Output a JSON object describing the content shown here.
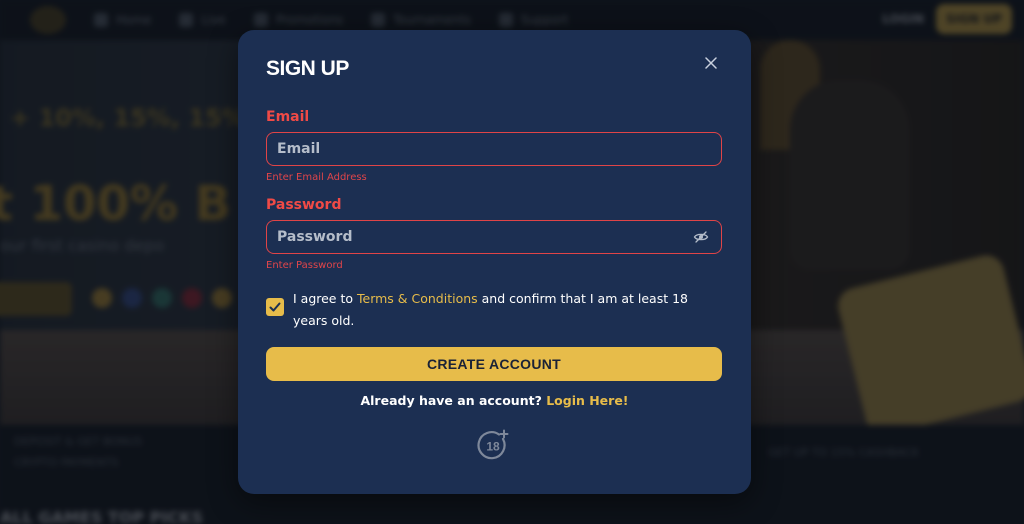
{
  "background": {
    "nav_items": [
      "Home",
      "Live",
      "Promotions",
      "Tournaments",
      "Support"
    ],
    "login_label": "LOGIN",
    "signup_label": "SIGN UP",
    "hero_line1": "+ 10%, 15%, 15%",
    "hero_line2": "t 100% B",
    "hero_line3": "our first casino depo",
    "bottom_text1": "DEPOSIT & GET BONUS",
    "bottom_text2": "CRYPTO PAYMENTS",
    "bottom_text3": "GET UP TO 15% CASHBACK",
    "bottom_text4": "ALL GAMES  TOP PICKS"
  },
  "modal": {
    "title": "SIGN UP",
    "email": {
      "label": "Email",
      "placeholder": "Email",
      "error": "Enter Email Address"
    },
    "password": {
      "label": "Password",
      "placeholder": "Password",
      "error": "Enter Password"
    },
    "agree": {
      "checked": true,
      "prefix": "I agree to ",
      "link": "Terms & Conditions",
      "suffix": " and confirm that I am at least 18 years old."
    },
    "create_button": "CREATE ACCOUNT",
    "login_prompt": "Already have an account?",
    "login_link": "Login Here!"
  },
  "colors": {
    "modal_bg": "#1c2f52",
    "accent": "#e7bc4a",
    "error": "#f04a46"
  }
}
